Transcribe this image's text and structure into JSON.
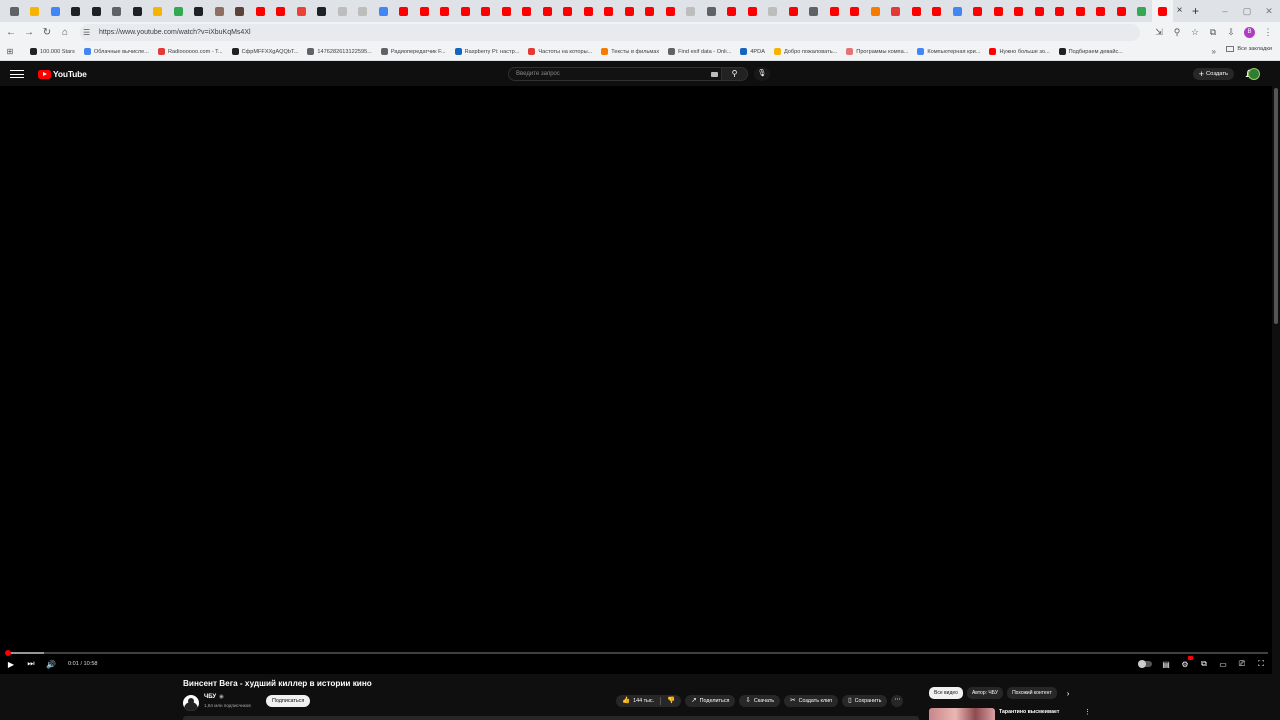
{
  "browser": {
    "tab_colors": [
      "#5f6368",
      "#f4b400",
      "#4285f4",
      "#202124",
      "#202124",
      "#5f6368",
      "#202124",
      "#f4b400",
      "#34a853",
      "#202124",
      "#8d6e63",
      "#5d4037",
      "#ff0000",
      "#ff0000",
      "#ea4335",
      "#202124",
      "#bdbdbd",
      "#bdbdbd",
      "#4285f4",
      "#ff0000",
      "#ff0000",
      "#ff0000",
      "#ff0000",
      "#ff0000",
      "#ff0000",
      "#ff0000",
      "#ff0000",
      "#ff0000",
      "#ff0000",
      "#ff0000",
      "#ff0000",
      "#ff0000",
      "#ff0000",
      "#bdbdbd",
      "#5f6368",
      "#ff0000",
      "#ff0000",
      "#bdbdbd",
      "#ff0000",
      "#5f6368",
      "#ff0000",
      "#ff0000",
      "#f57c00",
      "#e53935",
      "#ff0000",
      "#ff0000",
      "#4285f4",
      "#ff0000",
      "#ff0000",
      "#ff0000",
      "#ff0000",
      "#ff0000",
      "#ff0000",
      "#ff0000",
      "#ff0000",
      "#34a853",
      "#ff0000"
    ],
    "active_tab_close": "×",
    "new_tab": "+",
    "url": "https://www.youtube.com/watch?v=iXbuKqMs4Xl",
    "bookmarks": [
      {
        "label": "100.000 Stars",
        "color": "#202124"
      },
      {
        "label": "Облачные вычисле...",
        "color": "#4285f4"
      },
      {
        "label": "Radioooooo.com - T...",
        "color": "#e53935"
      },
      {
        "label": "СфрMFFXXgAQQbT...",
        "color": "#202124"
      },
      {
        "label": "1476282613122595...",
        "color": "#5f6368"
      },
      {
        "label": "Радиопередатчик F...",
        "color": "#5f6368"
      },
      {
        "label": "Raspberry Pi: настр...",
        "color": "#1565c0"
      },
      {
        "label": "Частоты на которы...",
        "color": "#e53935"
      },
      {
        "label": "Тексты в фильмах",
        "color": "#f57c00"
      },
      {
        "label": "Find exif data - Onli...",
        "color": "#5f6368"
      },
      {
        "label": "4PDA",
        "color": "#1565c0"
      },
      {
        "label": "Добро пожаловать...",
        "color": "#f4b400"
      },
      {
        "label": "Программы компа...",
        "color": "#e57373"
      },
      {
        "label": "Компьютерная кри...",
        "color": "#4285f4"
      },
      {
        "label": "Нужно больше зо...",
        "color": "#ff0000"
      },
      {
        "label": "Подбираем девайс...",
        "color": "#202124"
      }
    ],
    "all_bookmarks": "Все закладки"
  },
  "yt": {
    "logo_text": "YouTube",
    "search_placeholder": "Введите запрос",
    "create_label": "Создать"
  },
  "player": {
    "time": "0:01 / 10:58",
    "progress_fraction": 0.0015,
    "buffer_fraction": 0.03
  },
  "video": {
    "title": "Винсент Вега - худший киллер в истории кино",
    "channel": "ЧБУ",
    "verified": "◉",
    "subscribers": "1,84 млн подписчиков",
    "subscribe_label": "Подписаться",
    "likes": "144 тыс.",
    "share_label": "Поделиться",
    "download_label": "Скачать",
    "clip_label": "Создать клип",
    "save_label": "Сохранить"
  },
  "recommendations": {
    "chips": [
      "Все видео",
      "Автор: ЧБУ",
      "Похожий контент"
    ],
    "first_title": "Тарантино высмеивает"
  }
}
